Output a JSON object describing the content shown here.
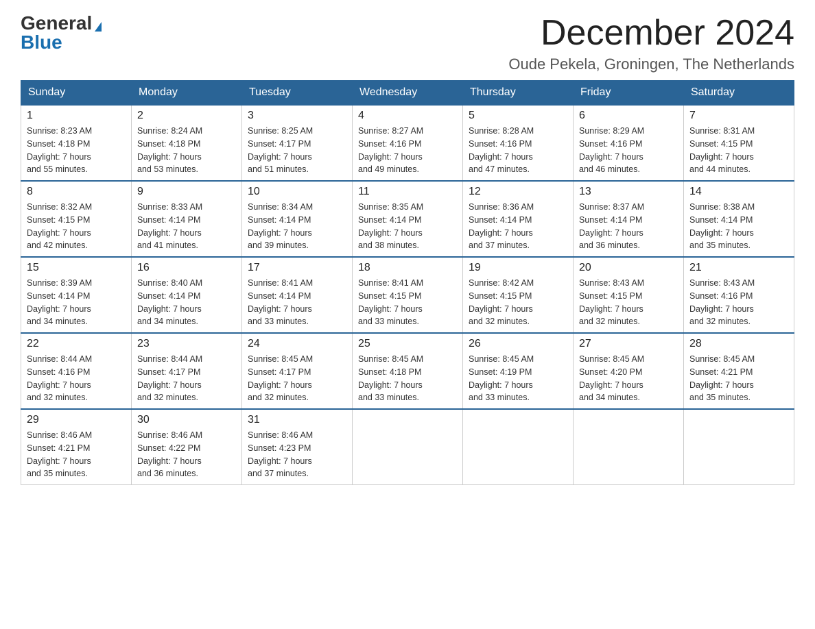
{
  "header": {
    "logo_general": "General",
    "logo_blue": "Blue",
    "month_title": "December 2024",
    "location": "Oude Pekela, Groningen, The Netherlands"
  },
  "weekdays": [
    "Sunday",
    "Monday",
    "Tuesday",
    "Wednesday",
    "Thursday",
    "Friday",
    "Saturday"
  ],
  "weeks": [
    [
      {
        "day": "1",
        "sunrise": "8:23 AM",
        "sunset": "4:18 PM",
        "daylight": "7 hours and 55 minutes."
      },
      {
        "day": "2",
        "sunrise": "8:24 AM",
        "sunset": "4:18 PM",
        "daylight": "7 hours and 53 minutes."
      },
      {
        "day": "3",
        "sunrise": "8:25 AM",
        "sunset": "4:17 PM",
        "daylight": "7 hours and 51 minutes."
      },
      {
        "day": "4",
        "sunrise": "8:27 AM",
        "sunset": "4:16 PM",
        "daylight": "7 hours and 49 minutes."
      },
      {
        "day": "5",
        "sunrise": "8:28 AM",
        "sunset": "4:16 PM",
        "daylight": "7 hours and 47 minutes."
      },
      {
        "day": "6",
        "sunrise": "8:29 AM",
        "sunset": "4:16 PM",
        "daylight": "7 hours and 46 minutes."
      },
      {
        "day": "7",
        "sunrise": "8:31 AM",
        "sunset": "4:15 PM",
        "daylight": "7 hours and 44 minutes."
      }
    ],
    [
      {
        "day": "8",
        "sunrise": "8:32 AM",
        "sunset": "4:15 PM",
        "daylight": "7 hours and 42 minutes."
      },
      {
        "day": "9",
        "sunrise": "8:33 AM",
        "sunset": "4:14 PM",
        "daylight": "7 hours and 41 minutes."
      },
      {
        "day": "10",
        "sunrise": "8:34 AM",
        "sunset": "4:14 PM",
        "daylight": "7 hours and 39 minutes."
      },
      {
        "day": "11",
        "sunrise": "8:35 AM",
        "sunset": "4:14 PM",
        "daylight": "7 hours and 38 minutes."
      },
      {
        "day": "12",
        "sunrise": "8:36 AM",
        "sunset": "4:14 PM",
        "daylight": "7 hours and 37 minutes."
      },
      {
        "day": "13",
        "sunrise": "8:37 AM",
        "sunset": "4:14 PM",
        "daylight": "7 hours and 36 minutes."
      },
      {
        "day": "14",
        "sunrise": "8:38 AM",
        "sunset": "4:14 PM",
        "daylight": "7 hours and 35 minutes."
      }
    ],
    [
      {
        "day": "15",
        "sunrise": "8:39 AM",
        "sunset": "4:14 PM",
        "daylight": "7 hours and 34 minutes."
      },
      {
        "day": "16",
        "sunrise": "8:40 AM",
        "sunset": "4:14 PM",
        "daylight": "7 hours and 34 minutes."
      },
      {
        "day": "17",
        "sunrise": "8:41 AM",
        "sunset": "4:14 PM",
        "daylight": "7 hours and 33 minutes."
      },
      {
        "day": "18",
        "sunrise": "8:41 AM",
        "sunset": "4:15 PM",
        "daylight": "7 hours and 33 minutes."
      },
      {
        "day": "19",
        "sunrise": "8:42 AM",
        "sunset": "4:15 PM",
        "daylight": "7 hours and 32 minutes."
      },
      {
        "day": "20",
        "sunrise": "8:43 AM",
        "sunset": "4:15 PM",
        "daylight": "7 hours and 32 minutes."
      },
      {
        "day": "21",
        "sunrise": "8:43 AM",
        "sunset": "4:16 PM",
        "daylight": "7 hours and 32 minutes."
      }
    ],
    [
      {
        "day": "22",
        "sunrise": "8:44 AM",
        "sunset": "4:16 PM",
        "daylight": "7 hours and 32 minutes."
      },
      {
        "day": "23",
        "sunrise": "8:44 AM",
        "sunset": "4:17 PM",
        "daylight": "7 hours and 32 minutes."
      },
      {
        "day": "24",
        "sunrise": "8:45 AM",
        "sunset": "4:17 PM",
        "daylight": "7 hours and 32 minutes."
      },
      {
        "day": "25",
        "sunrise": "8:45 AM",
        "sunset": "4:18 PM",
        "daylight": "7 hours and 33 minutes."
      },
      {
        "day": "26",
        "sunrise": "8:45 AM",
        "sunset": "4:19 PM",
        "daylight": "7 hours and 33 minutes."
      },
      {
        "day": "27",
        "sunrise": "8:45 AM",
        "sunset": "4:20 PM",
        "daylight": "7 hours and 34 minutes."
      },
      {
        "day": "28",
        "sunrise": "8:45 AM",
        "sunset": "4:21 PM",
        "daylight": "7 hours and 35 minutes."
      }
    ],
    [
      {
        "day": "29",
        "sunrise": "8:46 AM",
        "sunset": "4:21 PM",
        "daylight": "7 hours and 35 minutes."
      },
      {
        "day": "30",
        "sunrise": "8:46 AM",
        "sunset": "4:22 PM",
        "daylight": "7 hours and 36 minutes."
      },
      {
        "day": "31",
        "sunrise": "8:46 AM",
        "sunset": "4:23 PM",
        "daylight": "7 hours and 37 minutes."
      },
      null,
      null,
      null,
      null
    ]
  ],
  "labels": {
    "sunrise_prefix": "Sunrise: ",
    "sunset_prefix": "Sunset: ",
    "daylight_prefix": "Daylight: "
  }
}
